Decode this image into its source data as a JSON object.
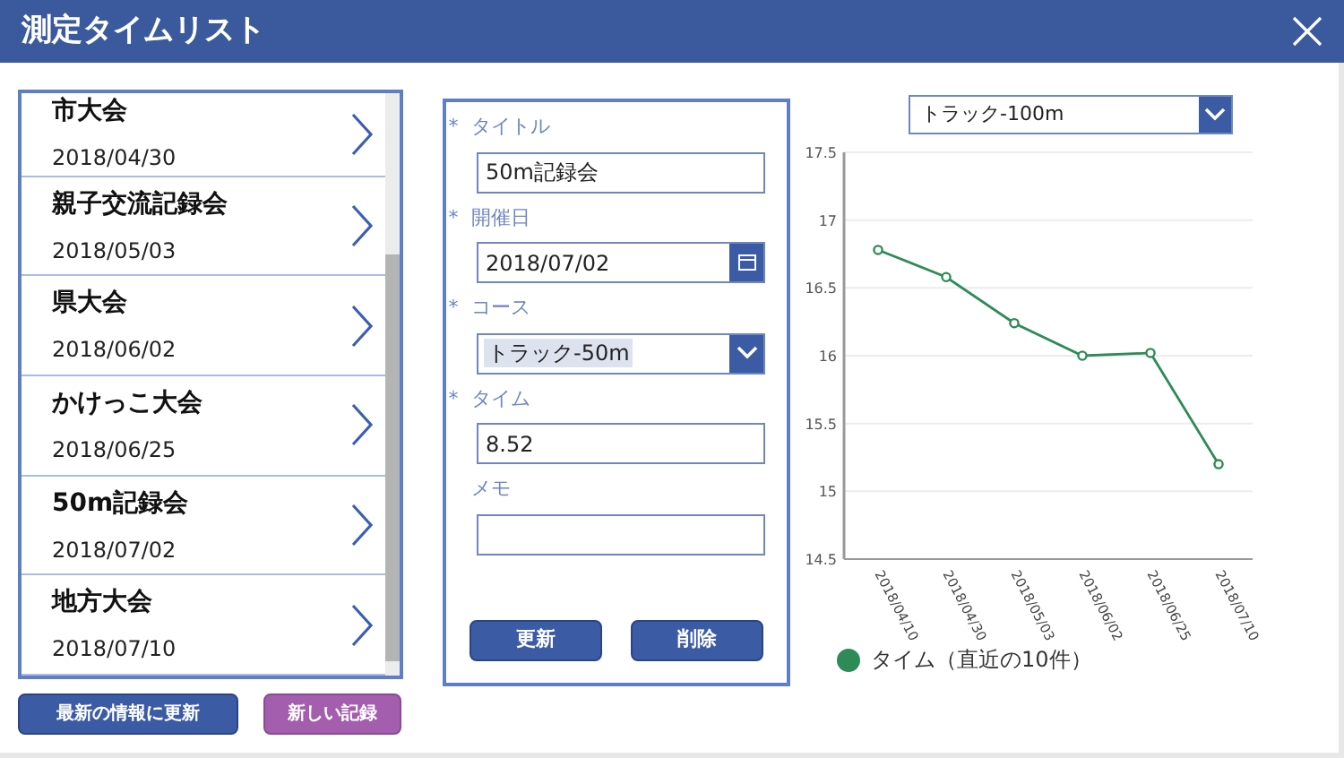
{
  "window": {
    "title": "測定タイムリスト"
  },
  "list": {
    "items": [
      {
        "name": "市大会",
        "date": "2018/04/30"
      },
      {
        "name": "親子交流記録会",
        "date": "2018/05/03"
      },
      {
        "name": "県大会",
        "date": "2018/06/02"
      },
      {
        "name": "かけっこ大会",
        "date": "2018/06/25"
      },
      {
        "name": "50m記録会",
        "date": "2018/07/02"
      },
      {
        "name": "地方大会",
        "date": "2018/07/10"
      }
    ]
  },
  "list_buttons": [
    {
      "label": "最新の情報に更新",
      "kind": "primary"
    },
    {
      "label": "新しい記録",
      "kind": "secondary"
    }
  ],
  "form": {
    "fields": [
      {
        "label": "タイトル",
        "required_mark": "*",
        "kind": "text",
        "value": "50m記録会"
      },
      {
        "label": "開催日",
        "required_mark": "*",
        "kind": "date",
        "value": "2018/07/02"
      },
      {
        "label": "コース",
        "required_mark": "*",
        "kind": "select",
        "value": "トラック-50m"
      },
      {
        "label": "タイム",
        "required_mark": "*",
        "kind": "text",
        "value": "8.52"
      },
      {
        "label": "メモ",
        "kind": "text"
      }
    ],
    "buttons": [
      "更新",
      "削除"
    ]
  },
  "chart_panel": {
    "course_select": "トラック-100m",
    "chart_data": {
      "type": "line",
      "categories": [
        "2018/04/10",
        "2018/04/30",
        "2018/05/03",
        "2018/06/02",
        "2018/06/25",
        "2018/07/10"
      ],
      "grid": true,
      "series": [
        {
          "name": "タイム（直近の10件）",
          "color": "#2e8b57",
          "marker": "circle",
          "values": [
            16.78,
            16.58,
            16.24,
            16.0,
            16.02,
            15.2
          ]
        }
      ],
      "ylim": [
        14.5,
        17.5
      ],
      "yticks": [
        {
          "value": 14.5,
          "label": "14.5"
        },
        {
          "value": 15,
          "label": "15"
        },
        {
          "value": 15.5,
          "label": "15.5"
        },
        {
          "value": 16,
          "label": "16"
        },
        {
          "value": 16.5,
          "label": "16.5"
        },
        {
          "value": 17,
          "label": "17"
        },
        {
          "value": 17.5,
          "label": "17.5"
        }
      ]
    }
  }
}
